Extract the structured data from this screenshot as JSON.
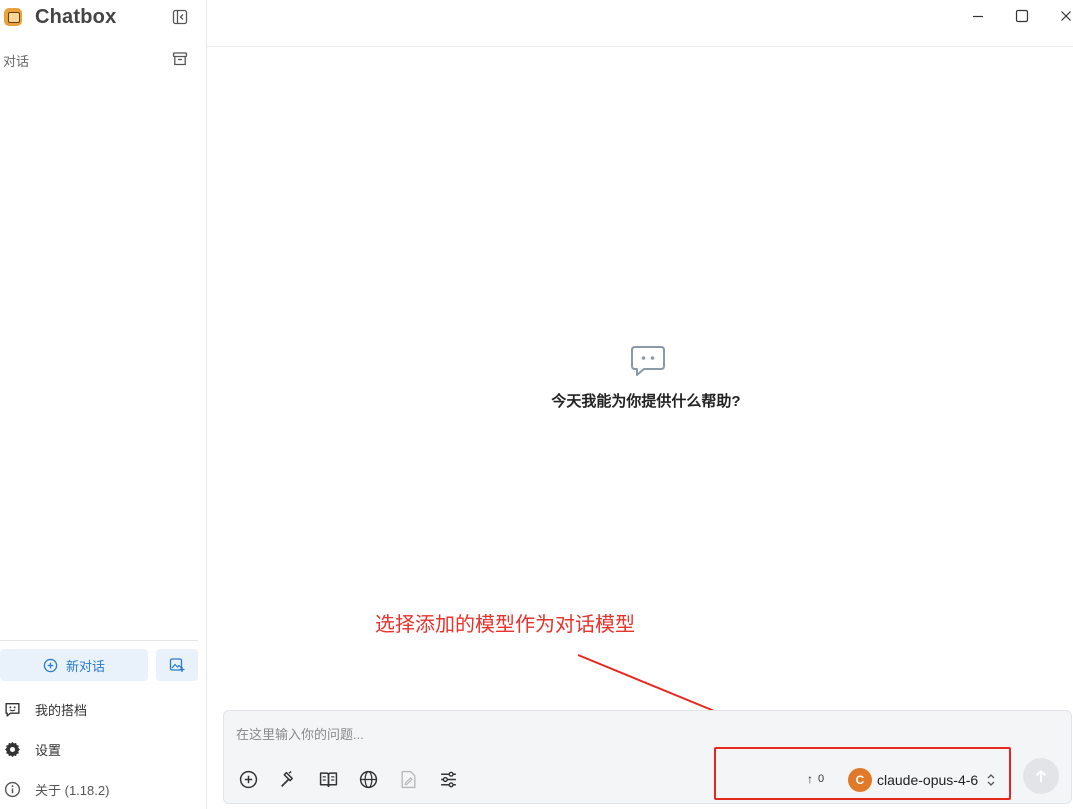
{
  "app": {
    "title": "Chatbox"
  },
  "sidebar": {
    "section_label": "对话",
    "new_chat_label": "新对话",
    "nav": [
      {
        "label": "我的搭档",
        "icon": "chat-smile-icon"
      },
      {
        "label": "设置",
        "icon": "gear-icon"
      },
      {
        "label": "关于 (1.18.2)",
        "icon": "info-icon"
      }
    ]
  },
  "main": {
    "empty_state_text": "今天我能为你提供什么帮助?"
  },
  "composer": {
    "placeholder": "在这里输入你的问题...",
    "value": "",
    "token_count": "0",
    "model_initial": "C",
    "model_name": "claude-opus-4-6"
  },
  "annotation": {
    "text": "选择添加的模型作为对话模型",
    "color": "#e8322c"
  },
  "colors": {
    "accent": "#2a7bd1",
    "model_avatar": "#e07a2a",
    "highlight": "#e5271f"
  }
}
